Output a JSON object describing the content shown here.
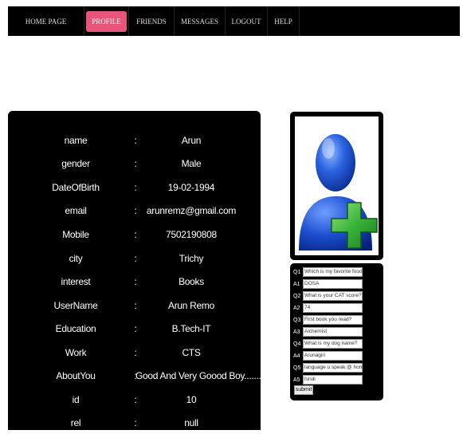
{
  "nav": {
    "items": [
      {
        "label": "HOME PAGE",
        "active": false
      },
      {
        "label": "PROFILE",
        "active": true
      },
      {
        "label": "FRIENDS",
        "active": false
      },
      {
        "label": "MESSAGES",
        "active": false
      },
      {
        "label": "LOGOUT",
        "active": false
      },
      {
        "label": "HELP",
        "active": false
      }
    ]
  },
  "profile": {
    "separator": ":",
    "fields": [
      {
        "label": "name",
        "value": "Arun"
      },
      {
        "label": "gender",
        "value": "Male"
      },
      {
        "label": "DateOfBirth",
        "value": "19-02-1994"
      },
      {
        "label": "email",
        "value": "arunremz@gmail.com"
      },
      {
        "label": "Mobile",
        "value": "7502190808"
      },
      {
        "label": "city",
        "value": "Trichy"
      },
      {
        "label": "interest",
        "value": "Books"
      },
      {
        "label": "UserName",
        "value": "Arun Remo"
      },
      {
        "label": "Education",
        "value": "B.Tech-IT"
      },
      {
        "label": "Work",
        "value": "CTS"
      },
      {
        "label": "AboutYou",
        "value": "Good And Very Goood Boy........."
      },
      {
        "label": "id",
        "value": "10"
      },
      {
        "label": "rel",
        "value": "null"
      }
    ]
  },
  "avatar": {
    "icon": "add-user-icon"
  },
  "qa": {
    "rows": [
      {
        "label": "Q1",
        "text": "Which is my favorite food?"
      },
      {
        "label": "A1",
        "text": "DOSA"
      },
      {
        "label": "Q2",
        "text": "What is your CAT score?"
      },
      {
        "label": "A2",
        "text": "74"
      },
      {
        "label": "Q3",
        "text": "First book you read?"
      },
      {
        "label": "A3",
        "text": "Alchemist"
      },
      {
        "label": "Q4",
        "text": "What is my dog name?"
      },
      {
        "label": "A4",
        "text": "Arunagiri"
      },
      {
        "label": "Q5",
        "text": "language u speak @ home?"
      },
      {
        "label": "A5",
        "text": "hindi"
      }
    ],
    "submit_label": "submit"
  },
  "colors": {
    "nav_bg": "#000000",
    "active_tab": "#e9547a",
    "panel_bg": "#000000",
    "user_icon_blue": "#1a4fd0",
    "plus_green": "#3bb33b"
  }
}
